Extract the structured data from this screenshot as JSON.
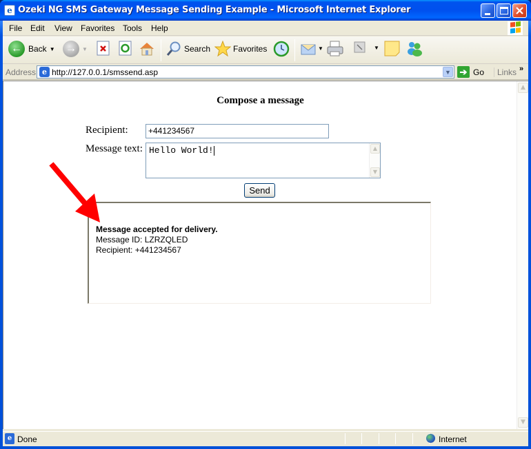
{
  "window": {
    "title": "Ozeki NG SMS Gateway Message Sending Example - Microsoft Internet Explorer"
  },
  "menu": {
    "items": [
      {
        "label": "File",
        "accel": "F"
      },
      {
        "label": "Edit",
        "accel": "E"
      },
      {
        "label": "View",
        "accel": "V"
      },
      {
        "label": "Favorites",
        "accel": "a"
      },
      {
        "label": "Tools",
        "accel": "T"
      },
      {
        "label": "Help",
        "accel": "H"
      }
    ]
  },
  "toolbar": {
    "back_label": "Back",
    "search_label": "Search",
    "favorites_label": "Favorites"
  },
  "address": {
    "label": "Address",
    "url": "http://127.0.0.1/smssend.asp",
    "go_label": "Go",
    "links_label": "Links",
    "links_more": "»"
  },
  "page": {
    "title": "Compose a message",
    "recipient_label": "Recipient:",
    "recipient_value": "+441234567",
    "message_label": "Message text:",
    "message_value": "Hello World!",
    "send_label": "Send",
    "result": {
      "status": "Message accepted for delivery.",
      "message_id": "Message ID: LZRZQLED",
      "recipient": "Recipient: +441234567"
    },
    "annotation_color": "#ff0000"
  },
  "statusbar": {
    "status": "Done",
    "zone": "Internet"
  }
}
